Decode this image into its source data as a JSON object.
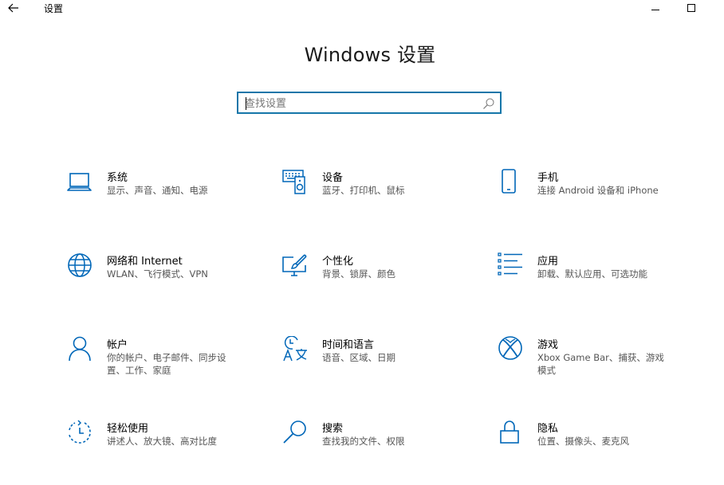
{
  "titlebar": {
    "app_title": "设置"
  },
  "main": {
    "title": "Windows 设置",
    "search": {
      "placeholder": "查找设置",
      "value": ""
    }
  },
  "tiles": [
    {
      "icon": "laptop-icon",
      "title": "系统",
      "desc": "显示、声音、通知、电源"
    },
    {
      "icon": "keyboard-speaker-icon",
      "title": "设备",
      "desc": "蓝牙、打印机、鼠标"
    },
    {
      "icon": "phone-icon",
      "title": "手机",
      "desc": "连接 Android 设备和 iPhone"
    },
    {
      "icon": "globe-icon",
      "title": "网络和 Internet",
      "desc": "WLAN、飞行模式、VPN"
    },
    {
      "icon": "paint-brush-icon",
      "title": "个性化",
      "desc": "背景、锁屏、颜色"
    },
    {
      "icon": "app-list-icon",
      "title": "应用",
      "desc": "卸载、默认应用、可选功能"
    },
    {
      "icon": "person-icon",
      "title": "帐户",
      "desc": "你的帐户、电子邮件、同步设置、工作、家庭"
    },
    {
      "icon": "time-language-icon",
      "title": "时间和语言",
      "desc": "语音、区域、日期"
    },
    {
      "icon": "xbox-icon",
      "title": "游戏",
      "desc": "Xbox Game Bar、捕获、游戏模式"
    },
    {
      "icon": "ease-of-access-icon",
      "title": "轻松使用",
      "desc": "讲述人、放大镜、高对比度"
    },
    {
      "icon": "search-magnifier-icon",
      "title": "搜索",
      "desc": "查找我的文件、权限"
    },
    {
      "icon": "lock-icon",
      "title": "隐私",
      "desc": "位置、摄像头、麦克风"
    }
  ],
  "colors": {
    "accent": "#0067b8",
    "search_border": "#1676a9",
    "text": "#000000",
    "desc": "#555555"
  }
}
